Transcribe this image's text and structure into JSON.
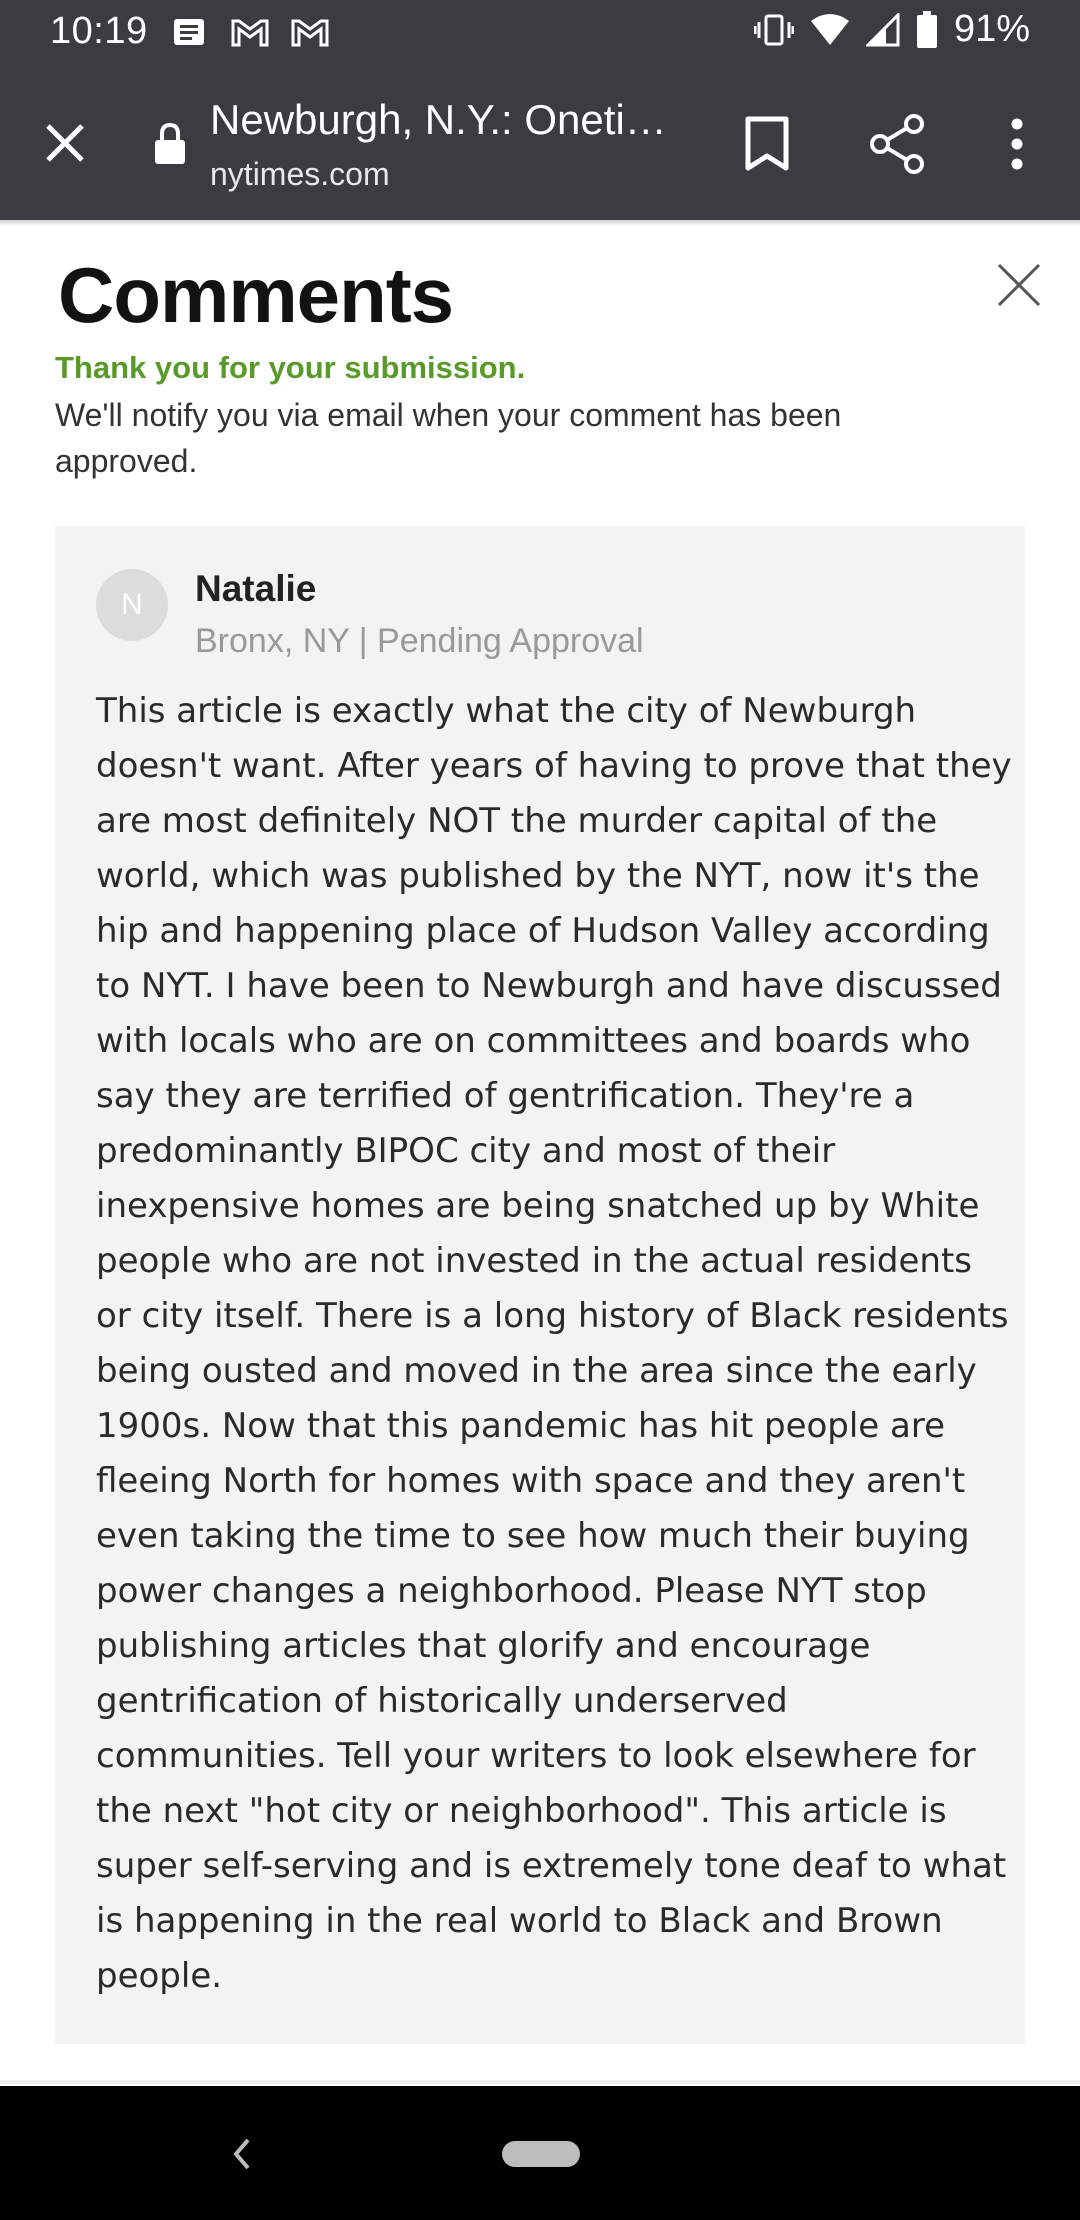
{
  "status_bar": {
    "time": "10:19",
    "battery_pct": "91%",
    "icons": [
      "message-icon",
      "gmail-icon",
      "gmail-icon",
      "vibrate-icon",
      "wifi-icon",
      "signal-icon",
      "battery-icon"
    ]
  },
  "browser": {
    "page_title": "Newburgh, N.Y.: Oneti…",
    "domain": "nytimes.com",
    "icons": [
      "close-icon",
      "lock-icon",
      "bookmark-icon",
      "share-icon",
      "more-vert-icon"
    ]
  },
  "comments_panel": {
    "title": "Comments",
    "thanks": "Thank you for your submission.",
    "notify": "We'll notify you via email when your comment has been approved."
  },
  "comment": {
    "avatar_initial": "N",
    "author": "Natalie",
    "meta": "Bronx, NY | Pending Approval",
    "body": "This article is exactly what the city of Newburgh doesn't want. After years of having to prove that they are most definitely NOT the murder capital of the world, which was published by the NYT, now it's the hip and happening place of Hudson Valley according to NYT. I have been to Newburgh and have discussed with locals who are on committees and boards who say they are terrified of gentrification. They're a predominantly BIPOC city and most of their inexpensive homes are being snatched up by White people who are not invested in the actual residents or city itself. There is a long history of Black residents being ousted and moved in the area since the early 1900s. Now that this pandemic has hit people are fleeing North for homes with space and they aren't even taking the time to see how much their buying power changes a neighborhood. Please NYT stop publishing articles that glorify and encourage gentrification of historically underserved communities. Tell your writers to look elsewhere for the next \"hot city or neighborhood\". This article is super self-serving and is extremely tone deaf to what is happening in the real world to Black and Brown people."
  },
  "colors": {
    "toolbar_bg": "#3b3c3f",
    "success_green": "#5a9a2a",
    "card_bg": "#f3f3f3",
    "nav_bg": "#000000"
  }
}
